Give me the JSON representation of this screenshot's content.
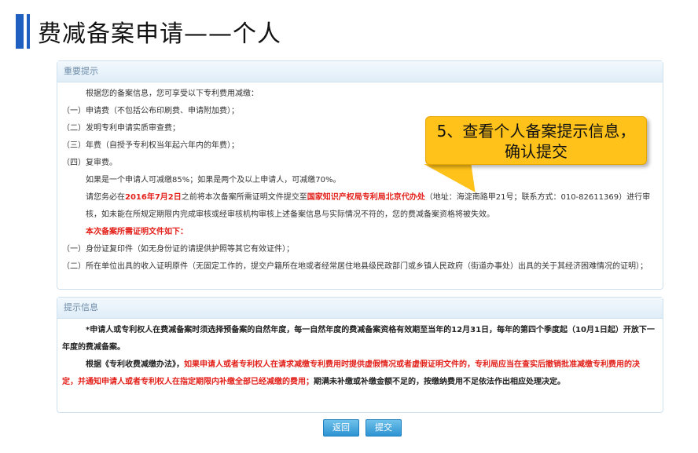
{
  "page_title": "费减备案申请——个人",
  "panel_important": {
    "header": "重要提示",
    "intro": "根据您的备案信息，您可享受以下专利费用减缴：",
    "items": [
      "（一）申请费（不包括公布印刷费、申请附加费）；",
      "（二）发明专利申请实质审查费；",
      "（三）年费（自授予专利权当年起六年内的年费）；",
      "（四）复审费。"
    ],
    "reduction": "如果是一个申请人可减缴85%；如果是两个及以上申请人，可减缴70%。",
    "deadline_pre": "请您务必在",
    "deadline_date": "2016年7月2日",
    "deadline_mid": "之前将本次备案所需证明文件提交至",
    "deadline_office": "国家知识产权局专利局北京代办处",
    "deadline_post": "（地址：海淀南路甲21号；联系方式：010-82611369）进行审核，如未能在所规定期限内完成审核或经审核机构审核上述备案信息与实际情况不符的，您的费减备案资格将被失效。",
    "docs_title": "本次备案所需证明文件如下：",
    "docs": [
      "（一）身份证复印件（如无身份证的请提供护照等其它有效证件）；",
      "（二）所在单位出具的收入证明原件（无固定工作的，提交户籍所在地或者经常居住地县级民政部门或乡镇人民政府（街道办事处）出具的关于其经济困难情况的证明）；"
    ]
  },
  "panel_info": {
    "header": "提示信息",
    "para1": "*申请人或专利权人在费减备案时须选择预备案的自然年度，每一自然年度的费减备案资格有效期至当年的12月31日，每年的第四个季度起（10月1日起）开放下一年度的费减备案。",
    "para2_pre": "根据《专利收费减缴办法》，",
    "para2_red": "如果申请人或者专利权人在请求减缴专利费用时提供虚假情况或者虚假证明文件的，专利局应当在查实后撤销批准减缴专利费用的决定，并通知申请人或者专利权人在指定期限内补缴全部已经减缴的费用；",
    "para2_post": "期满未补缴或补缴金额不足的，按缴纳费用不足依法作出相应处理决定。"
  },
  "callout": {
    "line1": "5、查看个人备案提示信息，",
    "line2": "确认提交"
  },
  "buttons": {
    "back": "返回",
    "submit": "提交"
  }
}
